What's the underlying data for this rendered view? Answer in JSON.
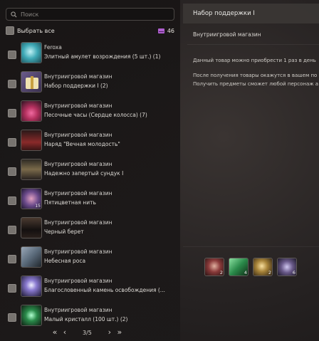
{
  "search": {
    "placeholder": "Поиск"
  },
  "select_all": {
    "label": "Выбрать все",
    "count": "46"
  },
  "items": [
    {
      "source": "Feroxa",
      "name": "Элитный амулет возрождения (5 шт.) (1)",
      "icon": "amulet-icon",
      "color": "#3fa9b6",
      "badge": ""
    },
    {
      "source": "Внутриигровой магазин",
      "name": "Набор поддержки I (2)",
      "icon": "gift-box-icon",
      "color": "#d8c48c",
      "badge": ""
    },
    {
      "source": "Внутриигровой магазин",
      "name": "Песочные часы (Сердце колосса) (7)",
      "icon": "hourglass-icon",
      "color": "#b3305e",
      "badge": ""
    },
    {
      "source": "Внутриигровой магазин",
      "name": "Наряд \"Вечная молодость\"",
      "icon": "outfit-icon",
      "color": "#8a2a2a",
      "badge": ""
    },
    {
      "source": "Внутриигровой магазин",
      "name": "Надежно запертый сундук I",
      "icon": "chest-icon",
      "color": "#7a6a4a",
      "badge": ""
    },
    {
      "source": "Внутриигровой магазин",
      "name": "Пятицветная нить",
      "icon": "thread-icon",
      "color": "#6a4a8a",
      "badge": "15"
    },
    {
      "source": "Внутриигровой магазин",
      "name": "Черный берет",
      "icon": "beret-icon",
      "color": "#3a302c",
      "badge": ""
    },
    {
      "source": "Внутриигровой магазин",
      "name": "Небесная роса",
      "icon": "dew-icon",
      "color": "#5a6a7a",
      "badge": ""
    },
    {
      "source": "Внутриигровой магазин",
      "name": "Благословенный камень освобождения (...",
      "icon": "crystal-icon",
      "color": "#5a4a8a",
      "badge": ""
    },
    {
      "source": "Внутриигровой магазин",
      "name": "Малый кристалл (100 шт.) (2)",
      "icon": "green-crystal-icon",
      "color": "#2a8a4a",
      "badge": ""
    }
  ],
  "pager": {
    "first": "«",
    "prev": "‹",
    "page": "3/5",
    "next": "›",
    "last": "»"
  },
  "detail": {
    "title": "Набор поддержки I",
    "source": "Внутриигровой магазин",
    "text1": "Данный товар можно приобрести 1 раз в день",
    "text2": "После получения товары окажутся в вашем по",
    "text3": "Получить предметы сможет любой персонаж а"
  },
  "attachments": [
    {
      "icon": "potion-red-icon",
      "count": "2",
      "color": "#8a3a3a"
    },
    {
      "icon": "green-book-icon",
      "count": "4",
      "color": "#2a8a4a"
    },
    {
      "icon": "gold-orb-icon",
      "count": "2",
      "color": "#a8843a"
    },
    {
      "icon": "gem-cluster-icon",
      "count": "6",
      "color": "#6a5a8a"
    }
  ]
}
